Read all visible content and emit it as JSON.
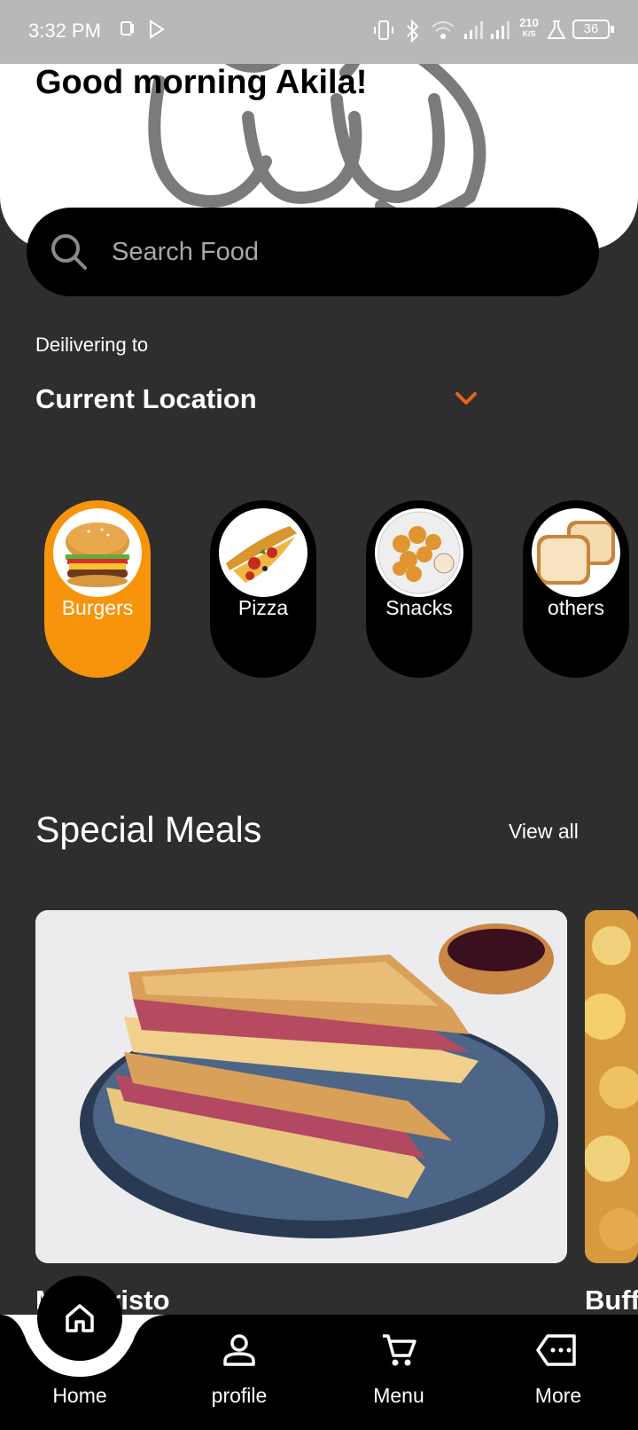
{
  "status_bar": {
    "time": "3:32 PM",
    "speed_value": "210",
    "speed_unit": "K/S",
    "battery": "36"
  },
  "header": {
    "greeting": "Good morning Akila!"
  },
  "search": {
    "placeholder": "Search Food"
  },
  "delivery": {
    "label": "Deilivering to",
    "location": "Current Location"
  },
  "categories": [
    {
      "label": "Burgers",
      "icon": "burger-image",
      "active": true
    },
    {
      "label": "Pizza",
      "icon": "pizza-image",
      "active": false
    },
    {
      "label": "Snacks",
      "icon": "snacks-image",
      "active": false
    },
    {
      "label": "others",
      "icon": "bread-image",
      "active": false
    }
  ],
  "special_meals": {
    "title": "Special Meals",
    "view_all": "View all",
    "items": [
      {
        "name": "M   o Cristo"
      },
      {
        "name": "Buff"
      }
    ]
  },
  "bottom_nav": {
    "items": [
      {
        "label": "Home",
        "icon": "home-icon"
      },
      {
        "label": "profile",
        "icon": "person-icon"
      },
      {
        "label": "Menu",
        "icon": "cart-icon"
      },
      {
        "label": "More",
        "icon": "more-tag-icon"
      }
    ]
  },
  "colors": {
    "background": "#2e2e2e",
    "accent": "#f7940b",
    "chevron": "#e8641b"
  }
}
